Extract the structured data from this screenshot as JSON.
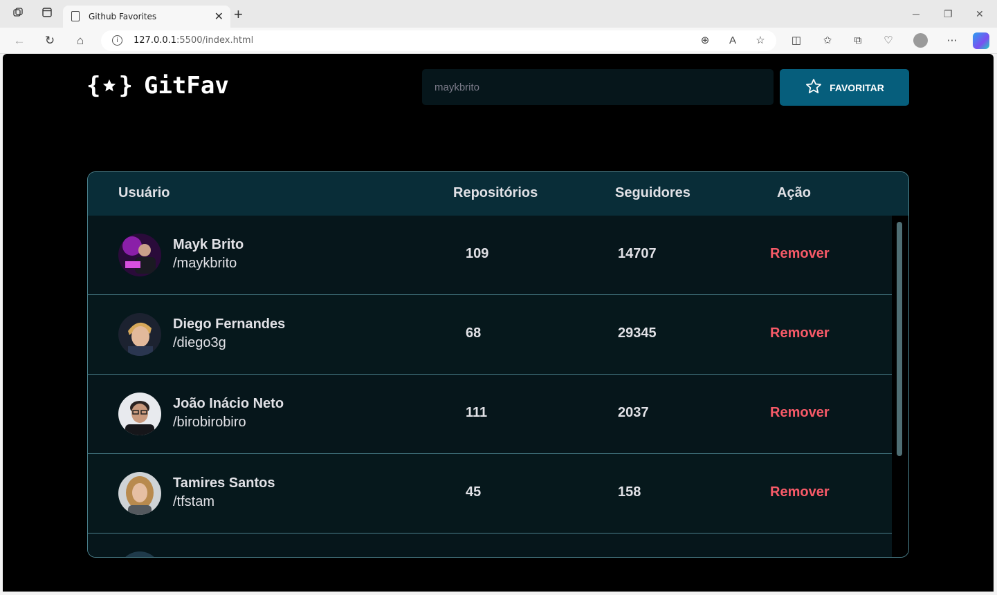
{
  "browser": {
    "tab_title": "Github Favorites",
    "url_host": "127.0.0.1",
    "url_rest": ":5500/index.html"
  },
  "app": {
    "logo_text": "GitFav",
    "search": {
      "value": "maykbrito"
    },
    "favorite_label": "FAVORITAR"
  },
  "table": {
    "headers": {
      "user": "Usuário",
      "repos": "Repositórios",
      "followers": "Seguidores",
      "action": "Ação"
    },
    "rows": [
      {
        "name": "Mayk Brito",
        "login": "/maykbrito",
        "repos": "109",
        "followers": "14707",
        "action": "Remover"
      },
      {
        "name": "Diego Fernandes",
        "login": "/diego3g",
        "repos": "68",
        "followers": "29345",
        "action": "Remover"
      },
      {
        "name": "João Inácio Neto",
        "login": "/birobirobiro",
        "repos": "111",
        "followers": "2037",
        "action": "Remover"
      },
      {
        "name": "Tamires Santos",
        "login": "/tfstam",
        "repos": "45",
        "followers": "158",
        "action": "Remover"
      }
    ]
  },
  "colors": {
    "accent": "#065e7c",
    "header_bg": "#092d38",
    "remove": "#f75a68",
    "border": "#4a808c"
  }
}
